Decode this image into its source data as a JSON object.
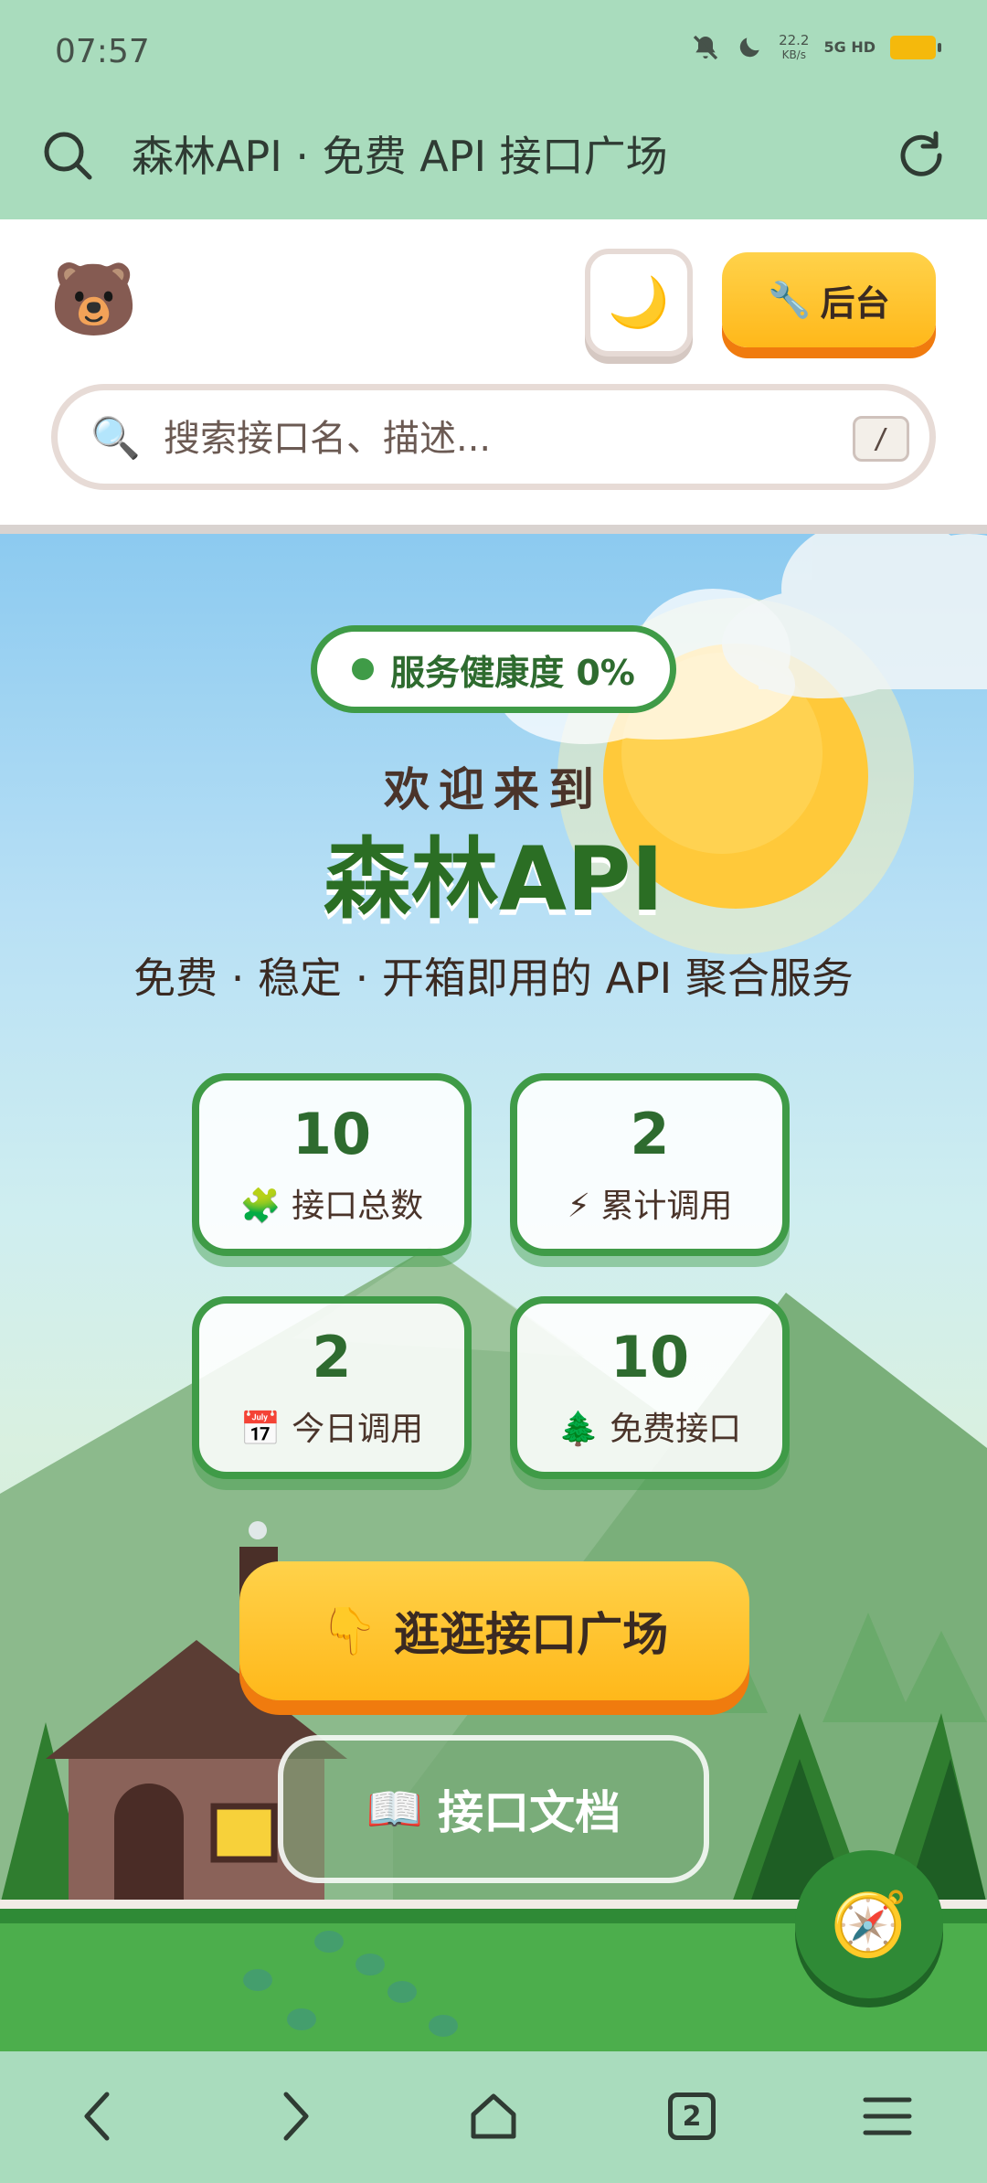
{
  "status_bar": {
    "time": "07:57",
    "net_speed": "22.2",
    "net_unit": "KB/s",
    "network": "5G HD",
    "battery_color": "#f5b90c"
  },
  "browser": {
    "title": "森林API · 免费 API 接口广场",
    "search_icon": "search-icon",
    "reload_icon": "reload-icon",
    "tab_count": "2"
  },
  "header": {
    "logo": "🐻",
    "theme_toggle": "🌙",
    "admin_button": {
      "icon": "🔧",
      "label": "后台"
    },
    "search": {
      "icon": "🔍",
      "placeholder": "搜索接口名、描述...",
      "shortcut": "/"
    }
  },
  "hero": {
    "health_badge": "服务健康度 0%",
    "welcome": "欢迎来到",
    "brand": "森林API",
    "tagline": "免费 · 稳定 · 开箱即用的 API 聚合服务",
    "stats": [
      {
        "value": "10",
        "icon": "🧩",
        "label": "接口总数"
      },
      {
        "value": "2",
        "icon": "⚡",
        "label": "累计调用"
      },
      {
        "value": "2",
        "icon": "📅",
        "label": "今日调用"
      },
      {
        "value": "10",
        "icon": "🌲",
        "label": "免费接口"
      }
    ],
    "primary_cta": {
      "icon": "👇",
      "label": "逛逛接口广场"
    },
    "secondary_cta": {
      "icon": "📖",
      "label": "接口文档"
    },
    "fab_icon": "🧭"
  },
  "colors": {
    "accent_green": "#3f9b47",
    "brand_orange": "#ffb81a",
    "chrome_green": "#a9dcbd"
  }
}
